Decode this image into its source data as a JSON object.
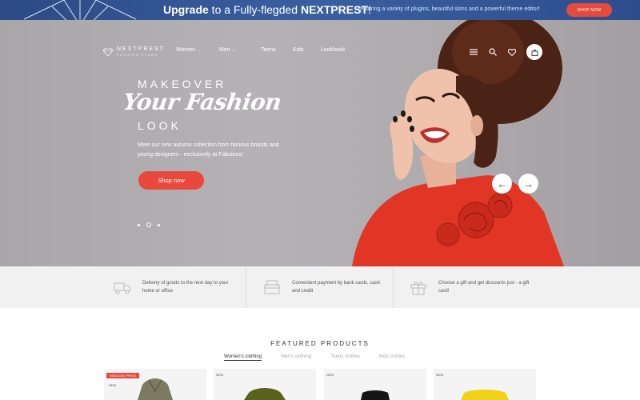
{
  "promo": {
    "headline_strong": "Upgrade",
    "headline_rest": " to a Fully-flegded ",
    "headline_brand": "NEXTPREST",
    "headline_end": "!",
    "subtext": "Featuring a variety of plugins, beautiful skins and a powerful theme editor!",
    "button": "SHOP NOW"
  },
  "header": {
    "logo_brand": "NEXTPREST",
    "logo_tag": "FASHION STORE",
    "nav": [
      {
        "label": "Women",
        "dropdown": true
      },
      {
        "label": "Men",
        "dropdown": true
      },
      {
        "label": "Teens",
        "dropdown": false
      },
      {
        "label": "Kids",
        "dropdown": false
      },
      {
        "label": "Lookbook",
        "dropdown": false
      }
    ],
    "icons": [
      "menu-icon",
      "search-icon",
      "heart-icon",
      "cart-icon"
    ]
  },
  "hero": {
    "line1": "MAKEOVER",
    "line2": "Your Fashion",
    "line3": "LOOK",
    "description": "Meet our new autumn collection from famous brands and young designers - exclusively at Fabulous!",
    "button": "Shop now",
    "slide_count": 3,
    "active_slide": 2
  },
  "features": [
    {
      "icon": "truck-icon",
      "text": "Delivery of goods to the next day to your home or office"
    },
    {
      "icon": "payment-icon",
      "text": "Convenient payment by bank cards, cash and credit"
    },
    {
      "icon": "gift-icon",
      "text": "Choose a gift and get discounts just - a gift card!"
    }
  ],
  "featured": {
    "title": "FEATURED PRODUCTS",
    "tabs": [
      "Women's clothing",
      "Men's clothing",
      "Teens clothes",
      "Kids clothes"
    ],
    "active_tab": 0,
    "products": [
      {
        "badge": "REDUCED PRICE",
        "badge2": "NEW",
        "color": "#7c7a62"
      },
      {
        "badge": "NEW",
        "badge2": "",
        "color": "#59631d"
      },
      {
        "badge": "NEW",
        "badge2": "",
        "color": "#151515"
      },
      {
        "badge": "NEW",
        "badge2": "",
        "color": "#f0d21a"
      }
    ]
  },
  "colors": {
    "accent": "#e9493d",
    "promo_bg": "#2e4d8d",
    "hero_bg": "#b2afb2"
  }
}
